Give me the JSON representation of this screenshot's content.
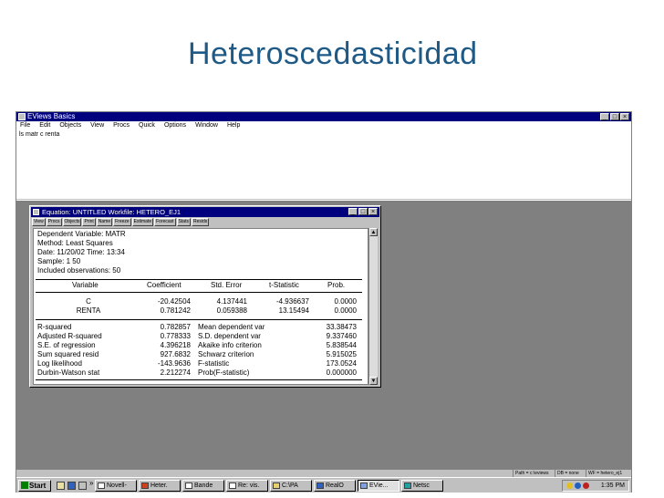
{
  "slide": {
    "title": "Heteroscedasticidad"
  },
  "app": {
    "title": "EViews Basics",
    "menu": [
      "File",
      "Edit",
      "Objects",
      "View",
      "Procs",
      "Quick",
      "Options",
      "Window",
      "Help"
    ],
    "command": "ls matr c renta"
  },
  "equation_window": {
    "title": "Equation: UNTITLED   Workfile: HETERO_EJ1",
    "toolbar": [
      "View",
      "Procs",
      "Objects",
      "Print",
      "Name",
      "Freeze",
      "Estimate",
      "Forecast",
      "Stats",
      "Resids"
    ],
    "header": [
      "Dependent Variable: MATR",
      "Method: Least Squares",
      "Date: 11/20/02   Time: 13:34",
      "Sample: 1 50",
      "Included observations: 50"
    ],
    "coef_headers": [
      "Variable",
      "Coefficient",
      "Std. Error",
      "t-Statistic",
      "Prob."
    ],
    "coef_rows": [
      [
        "C",
        "-20.42504",
        "4.137441",
        "-4.936637",
        "0.0000"
      ],
      [
        "RENTA",
        "0.781242",
        "0.059388",
        "13.15494",
        "0.0000"
      ]
    ],
    "stats_rows": [
      [
        "R-squared",
        "0.782857",
        "Mean dependent var",
        "33.38473"
      ],
      [
        "Adjusted R-squared",
        "0.778333",
        "S.D. dependent var",
        "9.337460"
      ],
      [
        "S.E. of regression",
        "4.396218",
        "Akaike info criterion",
        "5.838544"
      ],
      [
        "Sum squared resid",
        "927.6832",
        "Schwarz criterion",
        "5.915025"
      ],
      [
        "Log likelihood",
        "-143.9636",
        "F-statistic",
        "173.0524"
      ],
      [
        "Durbin-Watson stat",
        "2.212274",
        "Prob(F-statistic)",
        "0.000000"
      ]
    ]
  },
  "statusbar": {
    "path": "Path = c:\\eviews",
    "db": "DB = none",
    "wf": "WF = hetero_ej1"
  },
  "taskbar": {
    "start": "Start",
    "tasks": [
      "Novell-",
      "Heter.",
      "Bande",
      "Re: vis.",
      "C:\\PA",
      "RealO",
      "EVie...",
      "Netsc"
    ],
    "time": "1:35 PM"
  }
}
